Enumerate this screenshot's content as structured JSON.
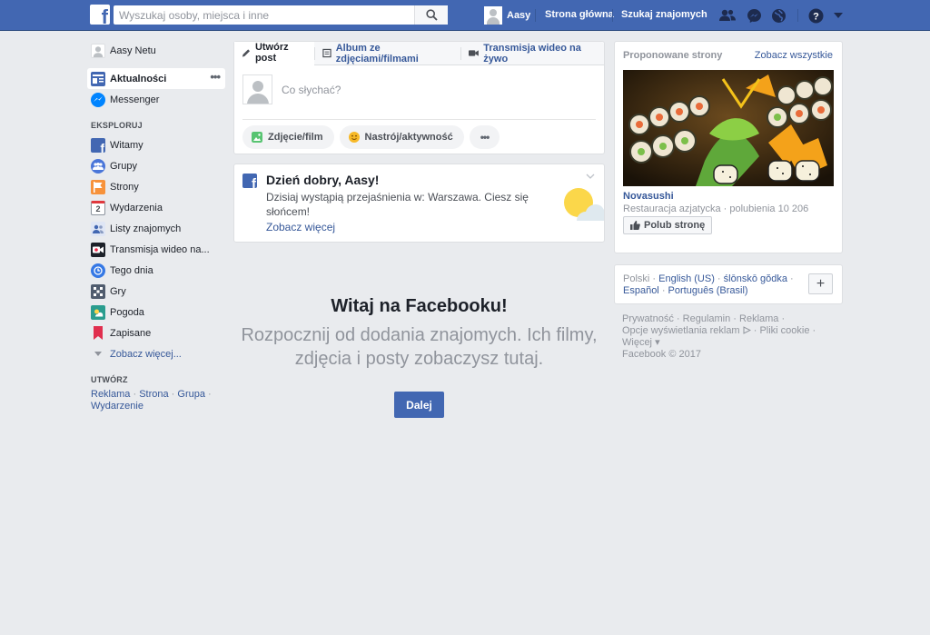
{
  "topbar": {
    "logo": "f",
    "search_placeholder": "Wyszukaj osoby, miejsca i inne",
    "user_name": "Aasy",
    "nav_home": "Strona główna",
    "nav_find_friends": "Szukaj znajomych"
  },
  "leftnav": {
    "profile_name": "Aasy Netu",
    "news_feed": "Aktualności",
    "messenger": "Messenger",
    "explore_title": "EKSPLORUJ",
    "explore": [
      "Witamy",
      "Grupy",
      "Strony",
      "Wydarzenia",
      "Listy znajomych",
      "Transmisja wideo na...",
      "Tego dnia",
      "Gry",
      "Pogoda",
      "Zapisane"
    ],
    "see_more": "Zobacz więcej...",
    "create_title": "UTWÓRZ",
    "create_links": [
      "Reklama",
      "Strona",
      "Grupa",
      "Wydarzenie"
    ]
  },
  "composer": {
    "tab_post": "Utwórz post",
    "tab_album": "Album ze zdjęciami/filmami",
    "tab_live": "Transmisja wideo na żywo",
    "placeholder": "Co słychać?",
    "action_photo": "Zdjęcie/film",
    "action_feeling": "Nastrój/aktywność"
  },
  "greeting": {
    "title": "Dzień dobry, Aasy!",
    "text": "Dzisiaj wystąpią przejaśnienia w: Warszawa. Ciesz się słońcem!",
    "link": "Zobacz więcej"
  },
  "welcome": {
    "title": "Witaj na Facebooku!",
    "text": "Rozpocznij od dodania znajomych. Ich filmy, zdjęcia i posty zobaczysz tutaj.",
    "button": "Dalej"
  },
  "suggested": {
    "title": "Proponowane strony",
    "see_all": "Zobacz wszystkie",
    "page_name": "Novasushi",
    "page_meta": "Restauracja azjatycka · polubienia 10 206",
    "like_button": "Polub stronę"
  },
  "languages": {
    "current": "Polski",
    "others": [
      "English (US)",
      "ślōnskō gŏdka",
      "Español",
      "Português (Brasil)"
    ]
  },
  "footer": {
    "links": [
      "Prywatność",
      "Regulamin",
      "Reklama",
      "Opcje wyświetlania reklam",
      "Pliki cookie",
      "Więcej"
    ],
    "copyright": "Facebook © 2017"
  },
  "colors": {
    "brand": "#4267b2",
    "link": "#365899",
    "background": "#e9ebee"
  }
}
